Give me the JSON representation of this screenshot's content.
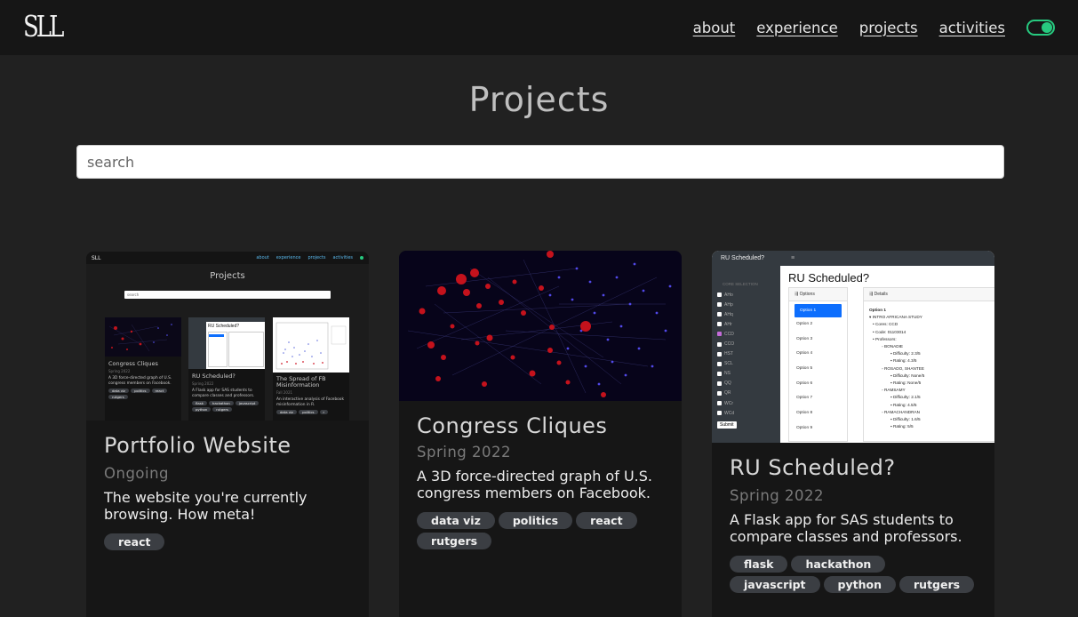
{
  "nav": {
    "logo": "SLL",
    "links": [
      "about",
      "experience",
      "projects",
      "activities"
    ]
  },
  "page": {
    "title": "Projects"
  },
  "search": {
    "placeholder": "search",
    "value": ""
  },
  "accent_color": "#27c97f",
  "projects": [
    {
      "title": "Portfolio Website",
      "date": "Ongoing",
      "description": "The website you're currently browsing. How meta!",
      "tags": [
        "react"
      ]
    },
    {
      "title": "Congress Cliques",
      "date": "Spring 2022",
      "description": "A 3D force-directed graph of U.S. congress members on Facebook.",
      "tags": [
        "data viz",
        "politics",
        "react",
        "rutgers"
      ]
    },
    {
      "title": "RU Scheduled?",
      "date": "Spring 2022",
      "description": "A Flask app for SAS students to compare classes and professors.",
      "tags": [
        "flask",
        "hackathon",
        "javascript",
        "python",
        "rutgers"
      ]
    }
  ],
  "thumb_portfolio": {
    "logo": "SLL",
    "nav": [
      "about",
      "experience",
      "projects",
      "activities"
    ],
    "title": "Projects",
    "search": "search",
    "cards": [
      {
        "title": "Congress Cliques",
        "date": "Spring 2022",
        "desc": "A 3D force-directed graph of U.S. congress members on Facebook.",
        "tags": [
          "data viz",
          "politics",
          "react",
          "rutgers"
        ]
      },
      {
        "title": "RU Scheduled?",
        "date": "Spring 2022",
        "desc": "A Flask app for SAS students to compare classes and professors.",
        "tags": [
          "flask",
          "hackathon",
          "javascript",
          "python",
          "rutgers"
        ]
      },
      {
        "title": "The Spread of FB Misinformation",
        "date": "Fall 2021",
        "desc": "An interactive analysis of Facebook misinformation in R.",
        "tags": [
          "data viz",
          "politics",
          "r"
        ]
      }
    ]
  },
  "thumb_rus": {
    "app": "RU Scheduled?",
    "menu": "≡",
    "sidebar_header": "CORE SELECTION",
    "core_codes": [
      "AHo",
      "AHp",
      "AHq",
      "AHr",
      "CCD",
      "CCO",
      "HST",
      "SCL",
      "NS",
      "QQ",
      "QR",
      "WCr",
      "WCd"
    ],
    "submit": "Submit",
    "heading": "RU Scheduled?",
    "options_title": "Options",
    "options": [
      "Option 1",
      "Option 2",
      "Option 3",
      "Option 4",
      "Option 5",
      "Option 6",
      "Option 7",
      "Option 8",
      "Option 9"
    ],
    "details_title": "Details",
    "details": [
      "Option 1",
      "▾ INTRO AFRICANA STUDY",
      "• Cores: CCD",
      "• Code: 01103014",
      "• Professors:",
      "◦ BONADIE",
      "▪ Difficulty: 2.3/5",
      "▪ Rating: 4.3/5",
      "◦ ROSADO, SHANTEE",
      "▪ Difficulty: None/5",
      "▪ Rating: None/5",
      "◦ RAMSAMY",
      "▪ Difficulty: 2.1/5",
      "▪ Rating: 4.5/5",
      "◦ RAMACHANDRAN",
      "▪ Difficulty: 1.6/5",
      "▪ Rating: 5/5"
    ]
  }
}
